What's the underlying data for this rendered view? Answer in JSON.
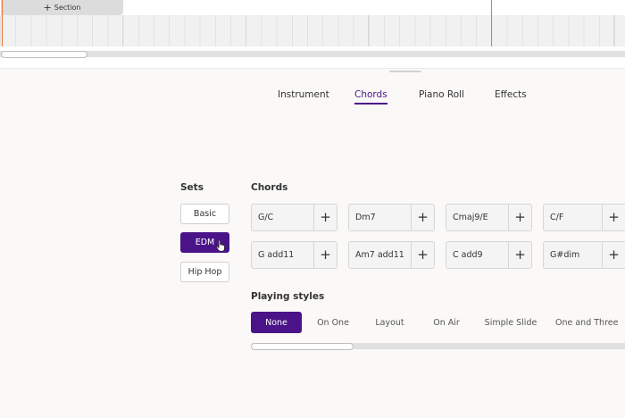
{
  "timeline": {
    "section_label": "Section",
    "add_icon": "plus-icon",
    "playhead_color": "#e8783c"
  },
  "tabs": [
    {
      "label": "Instrument",
      "active": false
    },
    {
      "label": "Chords",
      "active": true
    },
    {
      "label": "Piano Roll",
      "active": false
    },
    {
      "label": "Effects",
      "active": false
    }
  ],
  "sets": {
    "heading": "Sets",
    "items": [
      {
        "label": "Basic",
        "active": false
      },
      {
        "label": "EDM",
        "active": true
      },
      {
        "label": "Hip Hop",
        "active": false
      }
    ]
  },
  "chords": {
    "heading": "Chords",
    "add_symbol": "+",
    "items": [
      {
        "label": "G/C"
      },
      {
        "label": "Dm7"
      },
      {
        "label": "Cmaj9/E"
      },
      {
        "label": "C/F"
      },
      {
        "label": "G add11"
      },
      {
        "label": "Am7 add11"
      },
      {
        "label": "C add9"
      },
      {
        "label": "G#dim"
      }
    ]
  },
  "playing_styles": {
    "heading": "Playing styles",
    "items": [
      {
        "label": "None",
        "active": true
      },
      {
        "label": "On One",
        "active": false
      },
      {
        "label": "Layout",
        "active": false
      },
      {
        "label": "On Air",
        "active": false
      },
      {
        "label": "Simple Slide",
        "active": false
      },
      {
        "label": "One and Three",
        "active": false
      }
    ]
  },
  "colors": {
    "accent": "#4b1388",
    "background": "#faf9f7"
  }
}
